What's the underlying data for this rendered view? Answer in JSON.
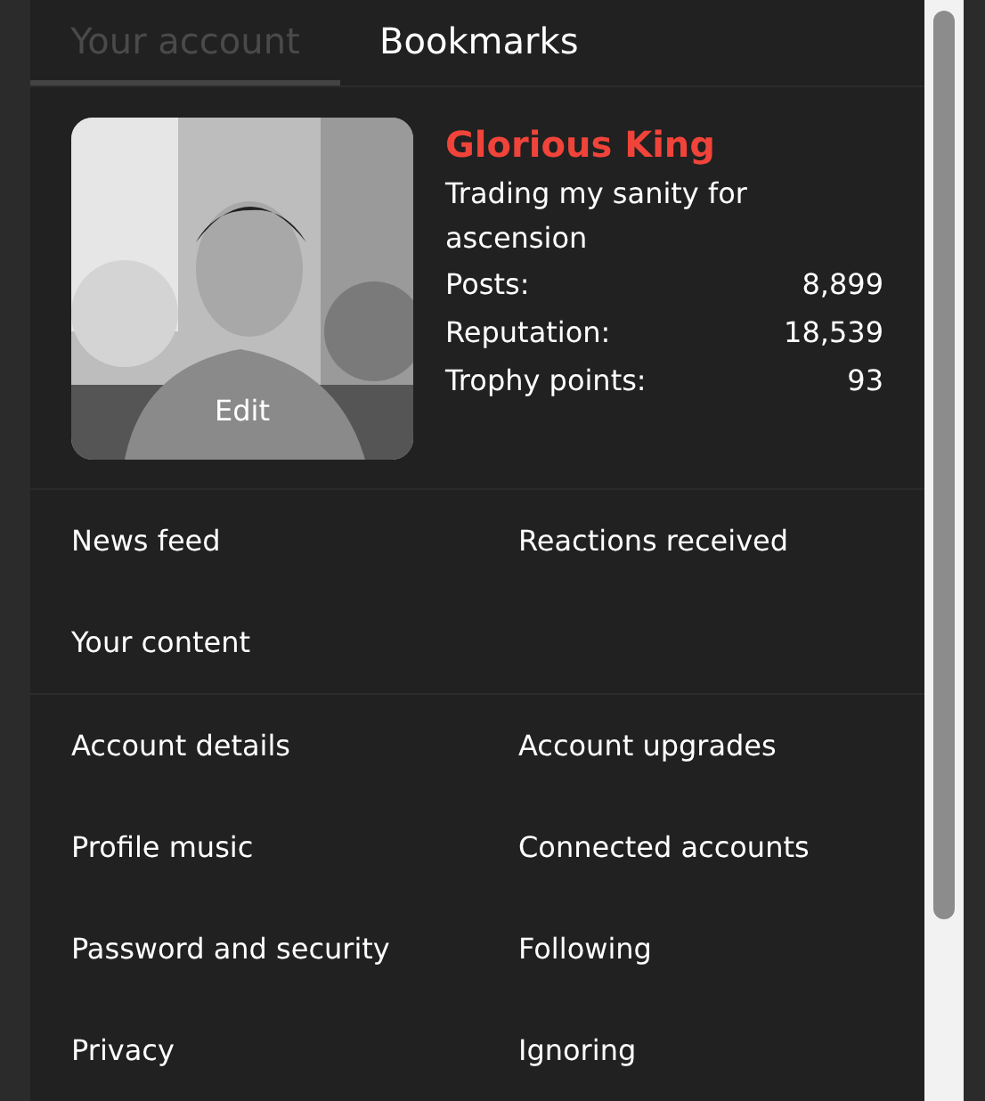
{
  "tabs": [
    {
      "label": "Your account",
      "selected": true
    },
    {
      "label": "Bookmarks",
      "selected": false
    }
  ],
  "profile": {
    "avatar": {
      "kind": "picture",
      "edit_label": "Edit"
    },
    "name": "Glorious King",
    "tagline": "Trading my sanity for ascension",
    "stats": [
      {
        "label": "Posts:",
        "value": "8,899"
      },
      {
        "label": "Reputation:",
        "value": "18,539"
      },
      {
        "label": "Trophy points:",
        "value": "93"
      }
    ]
  },
  "menu_groups": [
    {
      "items": [
        {
          "label": "News feed"
        },
        {
          "label": "Reactions received"
        },
        {
          "label": "Your content"
        }
      ]
    },
    {
      "items": [
        {
          "label": "Account details"
        },
        {
          "label": "Account upgrades"
        },
        {
          "label": "Profile music"
        },
        {
          "label": "Connected accounts"
        },
        {
          "label": "Password and security"
        },
        {
          "label": "Following"
        },
        {
          "label": "Privacy"
        },
        {
          "label": "Ignoring"
        }
      ]
    }
  ]
}
